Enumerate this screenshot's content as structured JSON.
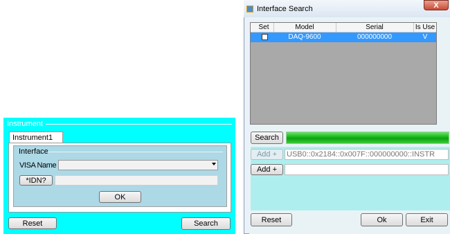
{
  "instrument": {
    "group_title": "Instrument",
    "tab_label": "Instrument1",
    "interface": {
      "group_title": "Interface",
      "visa_label": "VISA Name",
      "visa_value": "",
      "idn_button": "*IDN?",
      "idn_value": "",
      "ok_button": "OK"
    },
    "reset_button": "Reset",
    "search_button": "Search"
  },
  "search_window": {
    "title": "Interface Search",
    "close_glyph": "X",
    "table": {
      "headers": [
        "Set",
        "Model",
        "Serial",
        "Is Use"
      ],
      "rows": [
        {
          "set": false,
          "model": "DAQ-9600",
          "serial": "000000000",
          "is_use": "V"
        }
      ]
    },
    "search_button": "Search",
    "search_progress": 1.0,
    "add_button_1": "Add +",
    "address_1": "USB0::0x2184::0x007F::000000000::INSTR",
    "add_button_2": "Add +",
    "address_2": "",
    "reset_button": "Reset",
    "ok_button": "Ok",
    "exit_button": "Exit"
  },
  "colors": {
    "instrument_bg": "#00ffff",
    "interface_bg": "#add8e6",
    "selected_row": "#3399ff",
    "progress_green": "#12b812",
    "panel_cyan": "#afeeee"
  }
}
